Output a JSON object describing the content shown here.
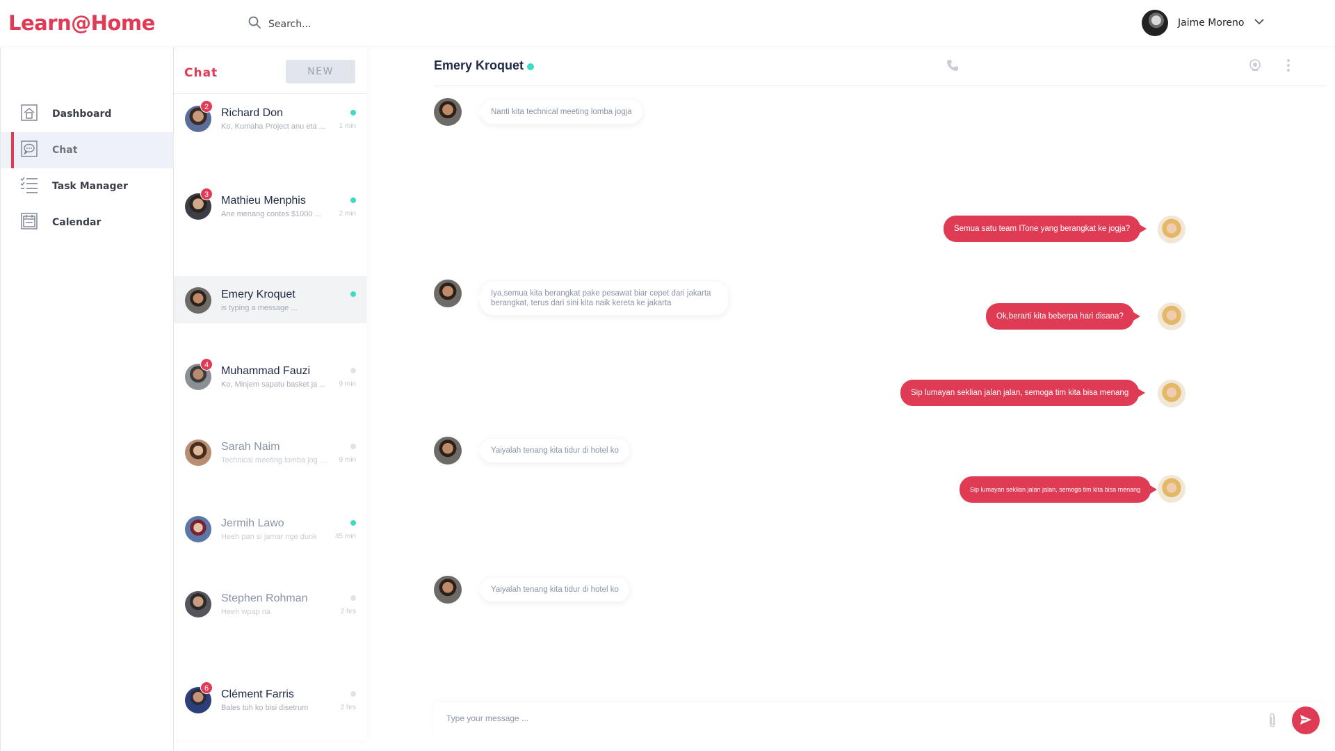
{
  "app": {
    "logo": "Learn@Home"
  },
  "header": {
    "search_placeholder": "Search...",
    "user_name": "Jaime Moreno"
  },
  "sidebar": {
    "items": [
      {
        "label": "Dashboard",
        "icon": "home-icon"
      },
      {
        "label": "Chat",
        "icon": "chat-bubble-icon",
        "active": true
      },
      {
        "label": "Task Manager",
        "icon": "checklist-icon"
      },
      {
        "label": "Calendar",
        "icon": "calendar-icon"
      }
    ]
  },
  "chatlist": {
    "title": "Chat",
    "new_button": "NEW",
    "contacts": [
      {
        "name": "Richard Don",
        "preview": "Ko, Kumaha Project anu eta ...",
        "time": "1 min",
        "badge": "2",
        "online": true
      },
      {
        "name": "Mathieu Menphis",
        "preview": "Ane menang contes $1000 ...",
        "time": "2 min",
        "badge": "3",
        "online": true
      },
      {
        "name": "Emery Kroquet",
        "preview": "is typing a message ...",
        "time": "",
        "badge": "",
        "online": true,
        "active": true
      },
      {
        "name": "Muhammad Fauzi",
        "preview": "Ko, Minjem sapatu basket ja ...",
        "time": "9 min",
        "badge": "4",
        "online": false
      },
      {
        "name": "Sarah Naim",
        "preview": "Technical meeting lomba jog ...",
        "time": "9 min",
        "badge": "",
        "online": false
      },
      {
        "name": "Jermih Lawo",
        "preview": "Heeh pan si jamar nge dunk",
        "time": "45 min",
        "badge": "",
        "online": true
      },
      {
        "name": "Stephen Rohman",
        "preview": "Heeh wpap na",
        "time": "2 hrs",
        "badge": "",
        "online": false
      },
      {
        "name": "Clément Farris",
        "preview": "Bales tuh ko bisi disetrum",
        "time": "2 hrs",
        "badge": "6",
        "online": false
      }
    ]
  },
  "conversation": {
    "contact_name": "Emery Kroquet",
    "status_color": "#3fdac4",
    "messages": [
      {
        "from": "them",
        "text": "Nanti  kita technical meeting lomba jogja"
      },
      {
        "from": "me",
        "text": "Semua satu team ITone yang berangkat ke jogja?"
      },
      {
        "from": "them",
        "text": "Iya,semua kita berangkat pake pesawat biar cepet dari  jakarta berangkat, terus dari sini kita naik kereta ke jakarta"
      },
      {
        "from": "me",
        "text": "Ok,berarti kita beberpa hari disana?"
      },
      {
        "from": "me",
        "text": "Sip lumayan seklian jalan jalan, semoga tim kita bisa menang"
      },
      {
        "from": "them",
        "text": "Yaiyalah tenang kita tidur di hotel ko"
      },
      {
        "from": "me",
        "text": "Sip lumayan seklian jalan jalan, semoga tim kita bisa menang"
      },
      {
        "from": "them",
        "text": "Yaiyalah tenang kita tidur di hotel ko"
      }
    ],
    "composer_placeholder": "Type your message ..."
  },
  "colors": {
    "accent": "#e03b55",
    "online": "#3fdac4",
    "offline": "#dfe3ea"
  }
}
